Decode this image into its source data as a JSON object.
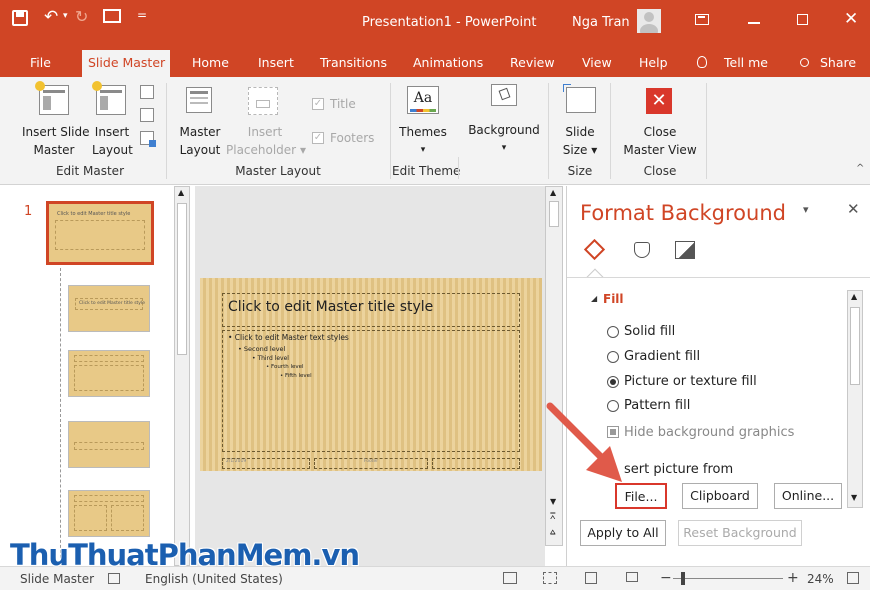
{
  "window": {
    "title": "Presentation1  -  PowerPoint",
    "user": "Nga Tran"
  },
  "tabs": [
    "File",
    "Slide Master",
    "Home",
    "Insert",
    "Transitions",
    "Animations",
    "Review",
    "View",
    "Help",
    "Tell me",
    "Share"
  ],
  "ribbon": {
    "insert_slide_master": [
      "Insert Slide",
      "Master"
    ],
    "insert_layout": [
      "Insert",
      "Layout"
    ],
    "master_layout": [
      "Master",
      "Layout"
    ],
    "insert_placeholder": [
      "Insert",
      "Placeholder"
    ],
    "title_check": "Title",
    "footers_check": "Footers",
    "themes": "Themes",
    "background": "Background",
    "slide_size": [
      "Slide",
      "Size"
    ],
    "close_master_view": [
      "Close",
      "Master View"
    ],
    "groups": {
      "edit_master": "Edit Master",
      "master_layout": "Master Layout",
      "edit_theme": "Edit Theme",
      "size": "Size",
      "close": "Close"
    }
  },
  "thumbnails": {
    "number": "1",
    "master_title": "Click to edit Master title style",
    "layout2_title": "Click to edit Master title style"
  },
  "slide": {
    "title": "Click to edit Master title style",
    "bullets": [
      "• Click to edit Master text styles",
      "• Second level",
      "• Third level",
      "• Fourth level",
      "• Fifth level"
    ],
    "footer_date": "2/1/2019",
    "footer_text": "Footer"
  },
  "format_background": {
    "title": "Format Background",
    "section": "Fill",
    "options": [
      "Solid fill",
      "Gradient fill",
      "Picture or texture fill",
      "Pattern fill"
    ],
    "selected": "Picture or texture fill",
    "hide_graphics": "Hide background graphics",
    "insert_from": "sert picture from",
    "file_btn": "File...",
    "clipboard_btn": "Clipboard",
    "online_btn": "Online...",
    "apply_all": "Apply to All",
    "reset": "Reset Background"
  },
  "status": {
    "view": "Slide Master",
    "language": "English (United States)",
    "zoom": "24%"
  },
  "watermark": "ThuThuatPhanMem.vn",
  "colors": {
    "accent": "#d04525",
    "arrow": "#e05a4a",
    "watermark_blue": "#1b5fb0",
    "watermark_red": "#d7292b"
  }
}
